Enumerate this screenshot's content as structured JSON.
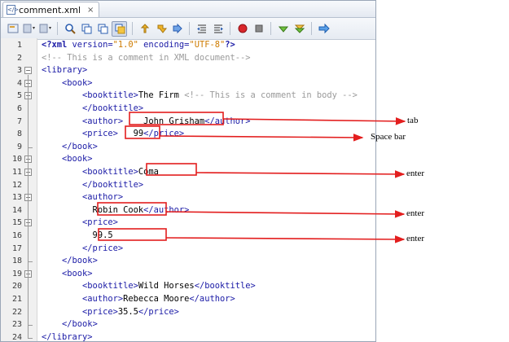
{
  "tab": {
    "filename": "comment.xml",
    "close": "×"
  },
  "toolbar": {
    "icons": [
      "source-history-icon",
      "back-icon",
      "forward-icon",
      "find-icon",
      "find-previous-icon",
      "find-next-icon",
      "toggle-highlight-icon",
      "previous-bookmark-icon",
      "next-bookmark-icon",
      "toggle-bookmark-icon",
      "shift-left-icon",
      "shift-right-icon",
      "start-macro-icon",
      "stop-macro-icon",
      "check-xml-icon",
      "validate-xml-icon",
      "xsl-transform-icon"
    ]
  },
  "lines": [
    {
      "n": "1",
      "fold": "",
      "segs": [
        [
          "pi",
          "<?xml"
        ],
        [
          "attr",
          " version="
        ],
        [
          "str",
          "\"1.0\""
        ],
        [
          "attr",
          " encoding="
        ],
        [
          "str",
          "\"UTF-8\""
        ],
        [
          "pi",
          "?>"
        ]
      ]
    },
    {
      "n": "2",
      "fold": "",
      "segs": [
        [
          "cmt",
          "<!-- This is a comment in XML document-->"
        ]
      ]
    },
    {
      "n": "3",
      "fold": "-",
      "segs": [
        [
          "tag",
          "<library>"
        ]
      ]
    },
    {
      "n": "4",
      "fold": "-",
      "segs": [
        [
          "plain",
          "    "
        ],
        [
          "tag",
          "<book>"
        ]
      ]
    },
    {
      "n": "5",
      "fold": "-",
      "segs": [
        [
          "plain",
          "        "
        ],
        [
          "tag",
          "<booktitle>"
        ],
        [
          "plain",
          "The Firm "
        ],
        [
          "cmt",
          "<!-- This is a comment in body -->"
        ]
      ]
    },
    {
      "n": "6",
      "fold": "",
      "segs": [
        [
          "plain",
          "        "
        ],
        [
          "tag",
          "</booktitle>"
        ]
      ]
    },
    {
      "n": "7",
      "fold": "",
      "segs": [
        [
          "plain",
          "        "
        ],
        [
          "tag",
          "<author>"
        ],
        [
          "plain",
          "    John Grisham"
        ],
        [
          "tag",
          "</author>"
        ]
      ]
    },
    {
      "n": "8",
      "fold": "",
      "segs": [
        [
          "plain",
          "        "
        ],
        [
          "tag",
          "<price>"
        ],
        [
          "plain",
          "   99"
        ],
        [
          "tag",
          "</price>"
        ]
      ]
    },
    {
      "n": "9",
      "fold": "",
      "segs": [
        [
          "plain",
          "    "
        ],
        [
          "tag",
          "</book>"
        ]
      ]
    },
    {
      "n": "10",
      "fold": "-",
      "segs": [
        [
          "plain",
          "    "
        ],
        [
          "tag",
          "<book>"
        ]
      ]
    },
    {
      "n": "11",
      "fold": "-",
      "segs": [
        [
          "plain",
          "        "
        ],
        [
          "tag",
          "<booktitle>"
        ],
        [
          "plain",
          "Coma"
        ]
      ]
    },
    {
      "n": "12",
      "fold": "",
      "segs": [
        [
          "plain",
          "        "
        ],
        [
          "tag",
          "</booktitle>"
        ]
      ]
    },
    {
      "n": "13",
      "fold": "-",
      "segs": [
        [
          "plain",
          "        "
        ],
        [
          "tag",
          "<author>"
        ]
      ]
    },
    {
      "n": "14",
      "fold": "",
      "segs": [
        [
          "plain",
          "          Robin Cook"
        ],
        [
          "tag",
          "</author>"
        ]
      ]
    },
    {
      "n": "15",
      "fold": "-",
      "segs": [
        [
          "plain",
          "        "
        ],
        [
          "tag",
          "<price>"
        ]
      ]
    },
    {
      "n": "16",
      "fold": "",
      "segs": [
        [
          "plain",
          "          99.5"
        ]
      ]
    },
    {
      "n": "17",
      "fold": "",
      "segs": [
        [
          "plain",
          "        "
        ],
        [
          "tag",
          "</price>"
        ]
      ]
    },
    {
      "n": "18",
      "fold": "",
      "segs": [
        [
          "plain",
          "    "
        ],
        [
          "tag",
          "</book>"
        ]
      ]
    },
    {
      "n": "19",
      "fold": "-",
      "segs": [
        [
          "plain",
          "    "
        ],
        [
          "tag",
          "<book>"
        ]
      ]
    },
    {
      "n": "20",
      "fold": "",
      "segs": [
        [
          "plain",
          "        "
        ],
        [
          "tag",
          "<booktitle>"
        ],
        [
          "plain",
          "Wild Horses"
        ],
        [
          "tag",
          "</booktitle>"
        ]
      ]
    },
    {
      "n": "21",
      "fold": "",
      "segs": [
        [
          "plain",
          "        "
        ],
        [
          "tag",
          "<author>"
        ],
        [
          "plain",
          "Rebecca Moore"
        ],
        [
          "tag",
          "</author>"
        ]
      ]
    },
    {
      "n": "22",
      "fold": "",
      "segs": [
        [
          "plain",
          "        "
        ],
        [
          "tag",
          "<price>"
        ],
        [
          "plain",
          "35.5"
        ],
        [
          "tag",
          "</price>"
        ]
      ]
    },
    {
      "n": "23",
      "fold": "",
      "segs": [
        [
          "plain",
          "    "
        ],
        [
          "tag",
          "</book>"
        ]
      ]
    },
    {
      "n": "24",
      "fold": "",
      "segs": [
        [
          "tag",
          "</library>"
        ]
      ]
    }
  ],
  "annotations": {
    "tab_label": "tab",
    "spacebar_label": "Space bar",
    "enter1": "enter",
    "enter2": "enter",
    "enter3": "enter"
  },
  "colors": {
    "annotation": "#e31e1e"
  }
}
